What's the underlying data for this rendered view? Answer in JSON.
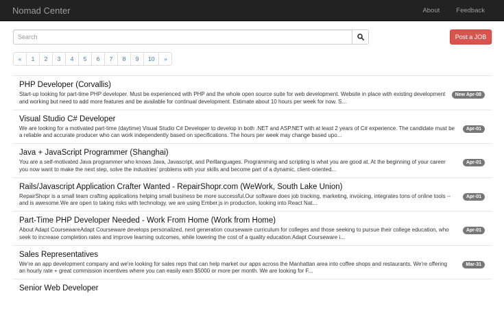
{
  "navbar": {
    "brand": "Nomad Center",
    "links": [
      "About",
      "Feedback"
    ]
  },
  "search": {
    "placeholder": "Search",
    "button_icon": "search-icon"
  },
  "post_button": "Post a JOB",
  "pagination": [
    "«",
    "1",
    "2",
    "3",
    "4",
    "5",
    "6",
    "7",
    "8",
    "9",
    "10",
    "»"
  ],
  "jobs": [
    {
      "title": "PHP Developer (Corvallis)",
      "description": "Start-up looking for part-time PHP developer. Must be experienced with PHP and the whole open source suite for web development. Website in place with existing development and working but need to add more features and be available for continual development. Estimate about 10 hours per week for now. S...",
      "badge": "New Apr-08"
    },
    {
      "title": "Visual Studio C# Developer",
      "description": "We are looking for a motivated part-time (daytime) Visual Studio C# Developer to develop in both .NET and ASP.NET with at least 2 years of C# experience. The candidate must be a reliable and accurate producer who can work independently based on specifications. The hours per week may change based upo...",
      "badge": "Apr-01"
    },
    {
      "title": "Java + JavaScript Programmer (Shanghai)",
      "description": "You are a self-motivated Java programmer who knows Java, Javascript, and Perllanguages. Programming and scripting is what you are good at. At the beginning of your career you now want to make the next step, solve the industries' problems with your skills and become part of a dynamic, client-oriented...",
      "badge": "Apr-01"
    },
    {
      "title": "Rails/Javascript Application Crafter Wanted - RepairShopr.com (WeWork, South Lake Union)",
      "description": "RepairShopr is a small team crafting applications helping small business be more successful.Our software does job tracking, marketing, invoicing, integrates tons of online tools -- and is awesome.We are open to taking risks with technology, we are using Ember.js in production, looking into React Nat...",
      "badge": "Apr-01"
    },
    {
      "title": "Part-Time PHP Developer Needed - Work From Home (Work from Home)",
      "description": "About Adapt CoursewareAdapt Courseware develops personalized, next generation courseware curriculum for colleges and those seeking to pursue their college education, who seek to increase completion rates and improve learning outcomes, while lowering the cost of a quality education.Adapt Courseware i...",
      "badge": "Apr-01"
    },
    {
      "title": "Sales Representatives",
      "description": "We're an app development company and we're looking for sales reps that can help market our apps across the Manhattan area into coffee shops and restaurants.  We're offering an hourly rate + great commission incentives where you can easily earn $5000 or more per month.  We are looking for F...",
      "badge": "Mar-31"
    },
    {
      "title": "Senior Web Developer",
      "description": "",
      "badge": ""
    }
  ]
}
